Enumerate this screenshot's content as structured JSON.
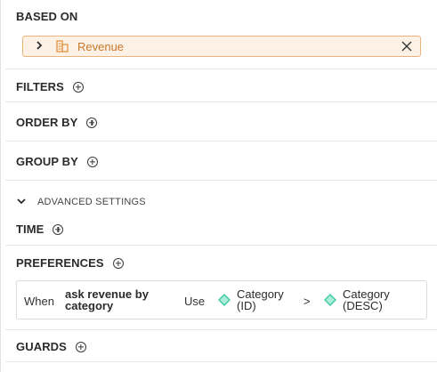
{
  "based_on": {
    "title": "BASED ON",
    "model_label": "Revenue",
    "model_icon": "model-table-icon",
    "chevron_icon": "chevron-right-icon",
    "remove_icon": "close-icon"
  },
  "sections": {
    "filters": "FILTERS",
    "order_by": "ORDER BY",
    "group_by": "GROUP BY",
    "time": "TIME",
    "preferences": "PREFERENCES",
    "guards": "GUARDS"
  },
  "advanced": {
    "label": "ADVANCED SETTINGS",
    "icon": "chevron-down-icon"
  },
  "preference_rule": {
    "when_label": "When",
    "when_value_line1": "ask revenue by",
    "when_value_line2": "category",
    "use_label": "Use",
    "field1_line1": "Category",
    "field1_line2": "(ID)",
    "separator": ">",
    "field2_line1": "Category",
    "field2_line2": "(DESC)",
    "field_icon": "dimension-diamond-icon"
  },
  "colors": {
    "based_bg": "#fdf1e6",
    "based_border": "#e9b47c",
    "based_text": "#c47a2c",
    "dimension_icon": "#3fc9a3"
  }
}
